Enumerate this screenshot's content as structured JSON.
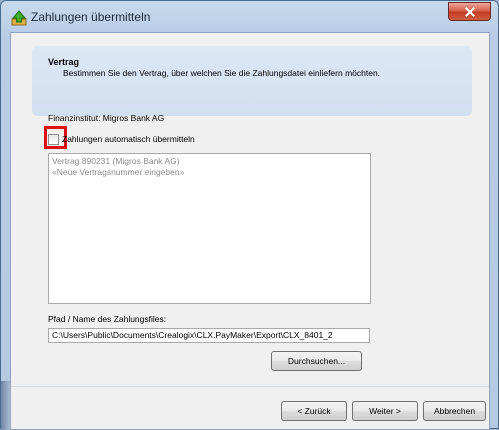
{
  "window": {
    "title": "Zahlungen übermitteln",
    "close_glyph": "x"
  },
  "header": {
    "title": "Vertrag",
    "description": "Bestimmen Sie den Vertrag, über welchen Sie die Zahlungsdatei einliefern möchten."
  },
  "form": {
    "institute_label": "Finanzinstitut: Migros Bank AG",
    "auto_transmit_label": "Zahlungen automatisch übermitteln",
    "auto_transmit_checked": false,
    "contracts": [
      "Vertrag 890231 (Migros Bank AG)",
      "«Neue Vertragsnummer eingeben»"
    ],
    "path_label": "Pfad / Name des Zahlungsfiles:",
    "path_value": "C:\\Users\\Public\\Documents\\Crealogix\\CLX.PayMaker\\Export\\CLX_8401_2",
    "browse_label": "Durchsuchen..."
  },
  "buttons": {
    "back": "< Zurück",
    "next": "Weiter >",
    "cancel": "Abbrechen"
  },
  "colors": {
    "highlight": "#e01010",
    "close_button": "#c9452e"
  }
}
